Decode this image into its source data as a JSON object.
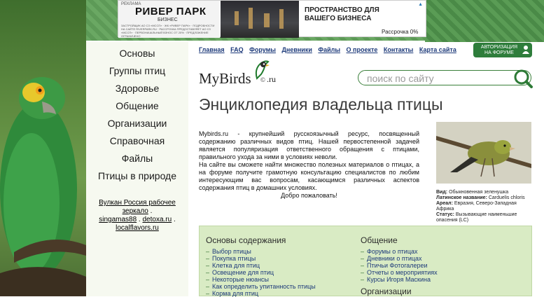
{
  "ad": {
    "label": "РЕКЛАМА",
    "brand": "РИВЕР ПАРК",
    "brand_sub": "БИЗНЕС",
    "fine_print": "ЗАСТРОЙЩИК АО СЗ «МССП» · ЖК «РИВЕР ПАРК» · ПОДРОБНОСТИ НА САЙТЕ RIVERPARK.RU · РАССРОЧКА ПРЕДОСТАВЛЯЕТ АО СЗ «МССП» · ПЕРВОНАЧАЛЬНЫЙ ВЗНОС ОТ 20% · ПРЕДЛОЖЕНИЕ ОГРАНИЧЕНО",
    "title": "ПРОСТРАНСТВО ДЛЯ ВАШЕГО БИЗНЕСА",
    "installment": "Рассрочка 0%",
    "info_icon": "info-triangle-icon"
  },
  "left_nav": [
    "Основы",
    "Группы птиц",
    "Здоровье",
    "Общение",
    "Организации",
    "Справочная",
    "Файлы",
    "Птицы в природе"
  ],
  "left_links": {
    "l1": "Вулкан Россия рабочее зеркало",
    "sep1": " .",
    "l2": "singamas88",
    "sep2": " . ",
    "l3": "detoxa.ru",
    "sep3": " .",
    "l4": "localflavors.ru"
  },
  "top_nav": [
    "Главная",
    "FAQ",
    "Форумы",
    "Дневники",
    "Файлы",
    "О проекте",
    "Контакты",
    "Карта сайта"
  ],
  "auth": {
    "line1": "АВТОРИЗАЦИЯ",
    "line2": "НА ФОРУМЕ",
    "icon": "user-lock-icon"
  },
  "logo": {
    "text": "MyBirds",
    "suffix": ".ru",
    "copyright": "©"
  },
  "search": {
    "placeholder": "поиск по сайту",
    "icon": "magnifier-icon"
  },
  "heading": "Энциклопедия владельца птицы",
  "intro": {
    "p1": "Mybirds.ru - крупнейший русскоязычный ресурс, посвященный содержанию различных видов птиц. Нашей первостепенной задачей является популяризация ответственного обращения с птицами, правильного ухода за ними в условиях неволи.",
    "p2": "На сайте вы сможете найти множество полезных материалов о птицах, а на форуме получите грамотную консультацию специалистов по любим интересующим вас вопросам, касающимся различных аспектов содержания птиц в домашних условиях.",
    "p3": "Добро пожаловать!"
  },
  "bird_card": {
    "species_label": "Вид:",
    "species": "Обыкновенная зеленушка",
    "latin_label": "Латинское название:",
    "latin": "Carduelis chloris",
    "area_label": "Ареал:",
    "area": "Евразия, Северо-Западная Африка",
    "status_label": "Статус:",
    "status": "Вызывающие наименьшие опасения (LC)"
  },
  "col1": {
    "heading": "Основы содержания",
    "items": [
      "Выбор птицы",
      "Покупка птицы",
      "Клетка для птиц",
      "Освещение для птиц",
      "Некоторые нюансы",
      "Как определить упитанность птицы",
      "Корма для птиц"
    ]
  },
  "col2": {
    "heading": "Общение",
    "items": [
      "Форумы о птицах",
      "Дневники о птицах",
      "Птичьи Фотогалереи",
      "Отчеты о мероприятиях",
      "Курсы Игоря Маскина"
    ],
    "heading2": "Организации"
  },
  "colors": {
    "link": "#1d3a7a",
    "accent": "#2e7d3b",
    "box": "#d9ebc4"
  }
}
